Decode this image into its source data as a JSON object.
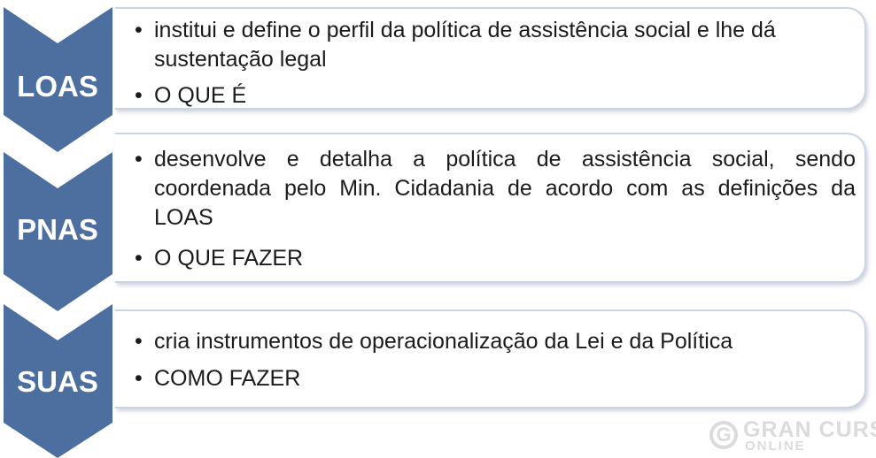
{
  "stages": [
    {
      "label": "LOAS",
      "bullets": [
        "institui e define o perfil da política de assistência social e lhe dá sustentação legal",
        "O QUE É"
      ]
    },
    {
      "label": "PNAS",
      "bullets": [
        "desenvolve e detalha a política de assistência social, sendo coordenada pelo Min. Cidadania de acordo com as definições da LOAS",
        "O QUE FAZER"
      ]
    },
    {
      "label": "SUAS",
      "bullets": [
        "cria instrumentos de operacionalização da Lei e da Política",
        "COMO FAZER"
      ]
    }
  ],
  "bullet_glyph": "•",
  "watermark": {
    "logo_letter": "G",
    "line1": "GRAN CURS",
    "line2": "ONLINE"
  },
  "colors": {
    "chevron": "#4d6fa0",
    "card_border": "#cbd4e2"
  }
}
